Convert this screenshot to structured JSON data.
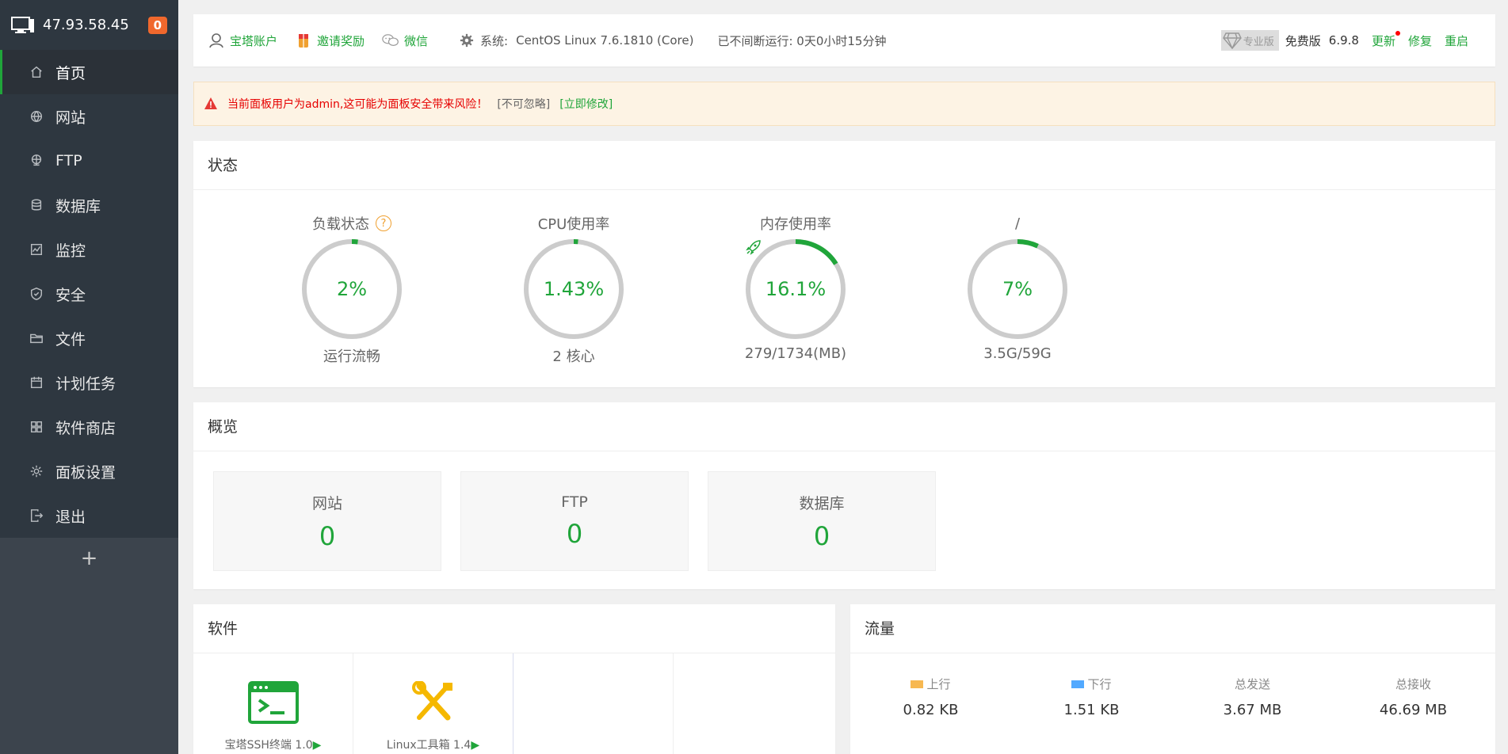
{
  "sidebar": {
    "ip": "47.93.58.45",
    "badge": "0",
    "items": [
      {
        "label": "首页",
        "icon": "home-icon"
      },
      {
        "label": "网站",
        "icon": "globe-icon"
      },
      {
        "label": "FTP",
        "icon": "ftp-icon"
      },
      {
        "label": "数据库",
        "icon": "database-icon"
      },
      {
        "label": "监控",
        "icon": "monitor-chart-icon"
      },
      {
        "label": "安全",
        "icon": "shield-icon"
      },
      {
        "label": "文件",
        "icon": "folder-icon"
      },
      {
        "label": "计划任务",
        "icon": "calendar-icon"
      },
      {
        "label": "软件商店",
        "icon": "grid-icon"
      },
      {
        "label": "面板设置",
        "icon": "gear-icon"
      },
      {
        "label": "退出",
        "icon": "logout-icon"
      }
    ],
    "add": "+"
  },
  "topbar": {
    "account": "宝塔账户",
    "invite": "邀请奖励",
    "wechat": "微信",
    "system_label": "系统:",
    "system_value": "CentOS Linux 7.6.1810 (Core)",
    "uptime": "已不间断运行: 0天0小时15分钟",
    "pro_tag": "专业版",
    "edition": "免费版",
    "version": "6.9.8",
    "update": "更新",
    "repair": "修复",
    "restart": "重启"
  },
  "alert": {
    "warning": "当前面板用户为admin,这可能为面板安全带来风险！",
    "ignore": "[不可忽略]",
    "fix": "[立即修改]"
  },
  "status": {
    "title": "状态",
    "gauges": [
      {
        "label": "负载状态",
        "value": "2%",
        "percent": 2,
        "sub": "运行流畅",
        "help": "?"
      },
      {
        "label": "CPU使用率",
        "value": "1.43%",
        "percent": 1.43,
        "sub": "2 核心"
      },
      {
        "label": "内存使用率",
        "value": "16.1%",
        "percent": 16.1,
        "sub": "279/1734(MB)"
      },
      {
        "label": "/",
        "value": "7%",
        "percent": 7,
        "sub": "3.5G/59G"
      }
    ]
  },
  "overview": {
    "title": "概览",
    "cards": [
      {
        "name": "网站",
        "count": "0"
      },
      {
        "name": "FTP",
        "count": "0"
      },
      {
        "name": "数据库",
        "count": "0"
      }
    ]
  },
  "software": {
    "title": "软件",
    "items": [
      {
        "name": "宝塔SSH终端 1.0",
        "play": "▶",
        "icon": "terminal-icon"
      },
      {
        "name": "Linux工具箱 1.4",
        "play": "▶",
        "icon": "tools-icon"
      }
    ]
  },
  "traffic": {
    "title": "流量",
    "stats": [
      {
        "label": "上行",
        "value": "0.82 KB",
        "color": "#f7b851"
      },
      {
        "label": "下行",
        "value": "1.51 KB",
        "color": "#52a9ff"
      },
      {
        "label": "总发送",
        "value": "3.67 MB"
      },
      {
        "label": "总接收",
        "value": "46.69 MB"
      }
    ]
  },
  "colors": {
    "accent": "#20a53a",
    "sidebar": "#3c444d",
    "badge": "#f0682d"
  }
}
